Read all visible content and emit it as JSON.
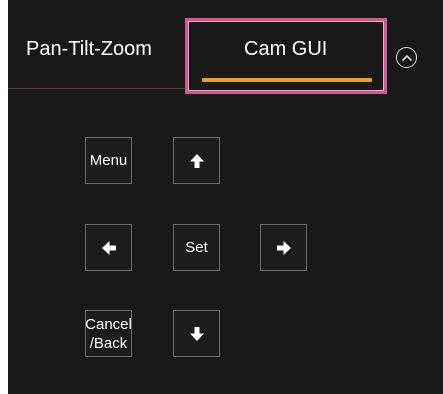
{
  "tabs": [
    {
      "label": "Pan-Tilt-Zoom"
    },
    {
      "label": "Cam GUI"
    }
  ],
  "collapse_icon": "chevron-up-circle-icon",
  "buttons": {
    "menu": "Menu",
    "set": "Set",
    "cancel_back_line1": "Cancel",
    "cancel_back_line2": "/Back"
  },
  "icons": {
    "up": "arrow-up-icon",
    "down": "arrow-down-icon",
    "left": "arrow-left-icon",
    "right": "arrow-right-icon"
  },
  "colors": {
    "panel_bg": "#191919",
    "active_tab_underline": "#e8a12a",
    "highlight_border": "#cf5b8d"
  }
}
